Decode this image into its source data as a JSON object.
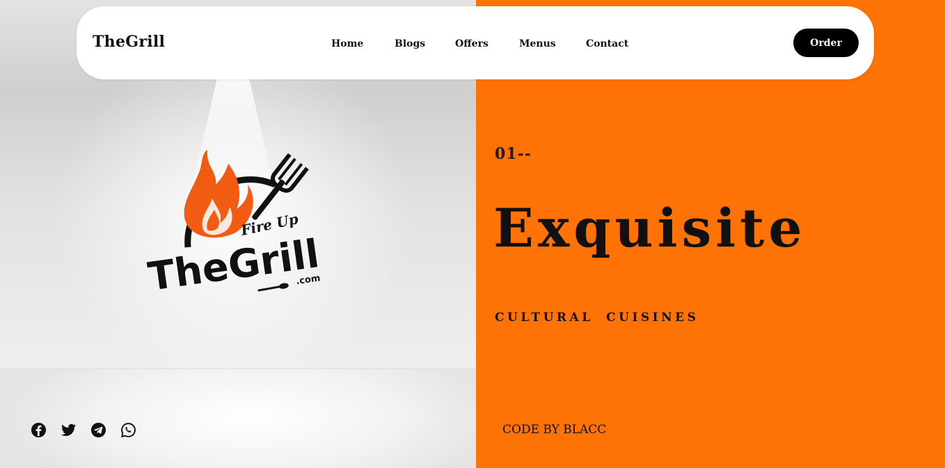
{
  "navbar": {
    "brand": "TheGrill",
    "links": [
      "Home",
      "Blogs",
      "Offers",
      "Menus",
      "Contact"
    ],
    "order_label": "Order"
  },
  "hero": {
    "slide_number": "01--",
    "title": "Exquisite",
    "subtitle": "CULTURAL CUISINES",
    "credit": "CODE BY BLACC"
  },
  "logo": {
    "tagline": "Fire Up",
    "name": "TheGrill",
    "suffix": ".com"
  },
  "social": [
    "facebook-icon",
    "twitter-icon",
    "telegram-icon",
    "whatsapp-icon"
  ],
  "colors": {
    "accent": "#ff7205",
    "dark": "#000000",
    "flame": "#f25b12"
  }
}
